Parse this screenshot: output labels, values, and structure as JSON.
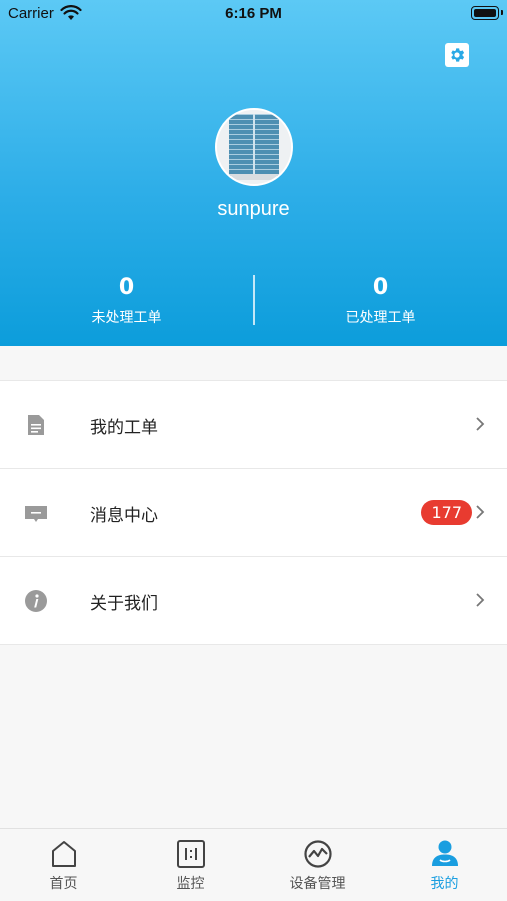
{
  "status_bar": {
    "carrier": "Carrier",
    "time": "6:16 PM"
  },
  "profile": {
    "username": "sunpure"
  },
  "stats": [
    {
      "value": "0",
      "label": "未处理工单"
    },
    {
      "value": "0",
      "label": "已处理工单"
    }
  ],
  "menu": [
    {
      "label": "我的工单",
      "icon": "document-icon"
    },
    {
      "label": "消息中心",
      "icon": "message-icon",
      "badge": "177"
    },
    {
      "label": "关于我们",
      "icon": "info-icon"
    }
  ],
  "tabs": [
    {
      "label": "首页",
      "icon": "home-icon"
    },
    {
      "label": "监控",
      "icon": "monitor-icon"
    },
    {
      "label": "设备管理",
      "icon": "device-management-icon"
    },
    {
      "label": "我的",
      "icon": "profile-icon",
      "active": true
    }
  ],
  "colors": {
    "accent": "#1a9ee0",
    "badge": "#e83b30",
    "header_top": "#5cc9f5",
    "header_bottom": "#0c9ddb"
  }
}
